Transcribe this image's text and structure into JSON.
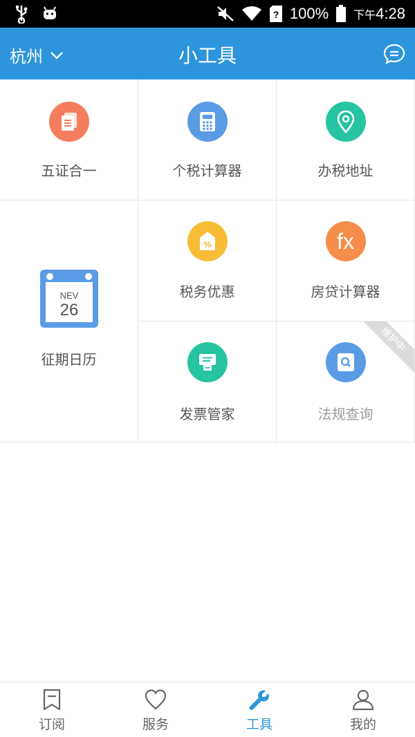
{
  "status_bar": {
    "battery_pct": "100%",
    "time_prefix": "下午",
    "time": "4:28",
    "icons": [
      "usb-icon",
      "android-icon",
      "mute-icon",
      "wifi-icon",
      "sim-unknown-icon",
      "battery-icon"
    ]
  },
  "header": {
    "city": "杭州",
    "title": "小工具",
    "message_icon": "chat-bubble-icon",
    "bg_color": "#2d95dc"
  },
  "tools": {
    "wuzheng": {
      "label": "五证合一",
      "icon": "documents-icon",
      "color": "#f47d5e"
    },
    "geshui": {
      "label": "个税计算器",
      "icon": "calculator-icon",
      "color": "#5a9be6"
    },
    "banshui": {
      "label": "办税地址",
      "icon": "location-pin-icon",
      "color": "#26c4a0"
    },
    "zhengqi": {
      "label": "征期日历",
      "icon": "calendar-icon",
      "calendar_month": "NEV",
      "calendar_day": "26",
      "color": "#5a9be6"
    },
    "shuiwu": {
      "label": "税务优惠",
      "icon": "percent-tag-icon",
      "color": "#f7bd37"
    },
    "fangdai": {
      "label": "房贷计算器",
      "icon": "fx-icon",
      "fx_text": "fx",
      "color": "#f68d4a"
    },
    "fapiao": {
      "label": "发票管家",
      "icon": "invoice-icon",
      "color": "#26c4a0"
    },
    "fagui": {
      "label": "法规查询",
      "icon": "search-doc-icon",
      "ribbon": "维护中",
      "color": "#5a9be6"
    }
  },
  "tabbar": {
    "items": [
      {
        "label": "订阅",
        "icon": "bookmark-icon"
      },
      {
        "label": "服务",
        "icon": "heart-icon"
      },
      {
        "label": "工具",
        "icon": "wrench-icon"
      },
      {
        "label": "我的",
        "icon": "user-icon"
      }
    ],
    "active_color": "#2d95dc"
  }
}
